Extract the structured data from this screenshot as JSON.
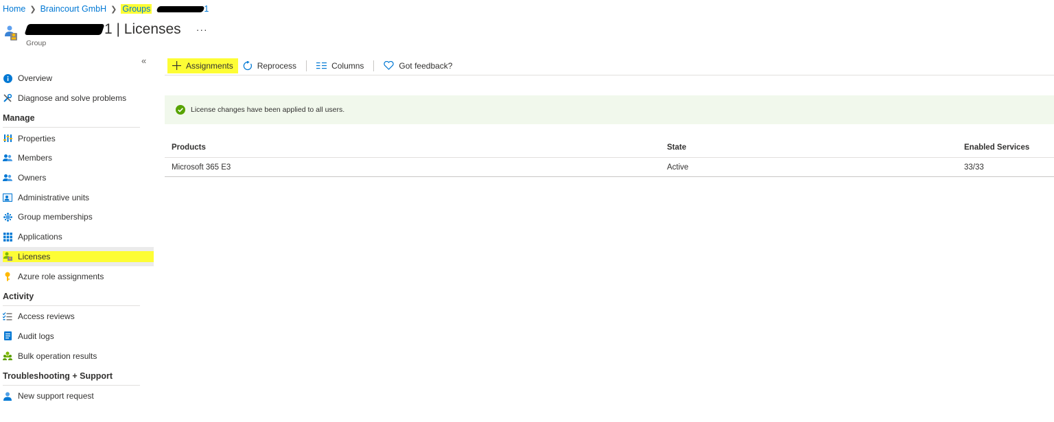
{
  "breadcrumb": {
    "items": [
      "Home",
      "Braincourt GmbH",
      "Groups"
    ],
    "last_suffix": "1",
    "separator": ">"
  },
  "header": {
    "title_suffix": "1 | Licenses",
    "subtitle": "Group",
    "more": "···"
  },
  "sidebar": {
    "collapse": "«",
    "top_items": [
      {
        "label": "Overview",
        "icon": "info-icon"
      },
      {
        "label": "Diagnose and solve problems",
        "icon": "wrench-icon"
      }
    ],
    "sections": [
      {
        "title": "Manage",
        "items": [
          {
            "label": "Properties",
            "icon": "properties-icon"
          },
          {
            "label": "Members",
            "icon": "members-icon"
          },
          {
            "label": "Owners",
            "icon": "owners-icon"
          },
          {
            "label": "Administrative units",
            "icon": "admin-units-icon"
          },
          {
            "label": "Group memberships",
            "icon": "group-memberships-icon"
          },
          {
            "label": "Applications",
            "icon": "applications-icon"
          },
          {
            "label": "Licenses",
            "icon": "licenses-icon",
            "active": true
          },
          {
            "label": "Azure role assignments",
            "icon": "key-icon"
          }
        ]
      },
      {
        "title": "Activity",
        "items": [
          {
            "label": "Access reviews",
            "icon": "access-reviews-icon"
          },
          {
            "label": "Audit logs",
            "icon": "audit-logs-icon"
          },
          {
            "label": "Bulk operation results",
            "icon": "bulk-operation-icon"
          }
        ]
      },
      {
        "title": "Troubleshooting + Support",
        "items": [
          {
            "label": "New support request",
            "icon": "support-request-icon"
          }
        ]
      }
    ]
  },
  "toolbar": {
    "assignments": "Assignments",
    "reprocess": "Reprocess",
    "columns": "Columns",
    "feedback": "Got feedback?"
  },
  "notice": {
    "text": "License changes have been applied to all users."
  },
  "table": {
    "columns": [
      "Products",
      "State",
      "Enabled Services"
    ],
    "rows": [
      [
        "Microsoft 365 E3",
        "Active",
        "33/33"
      ]
    ]
  },
  "colors": {
    "link": "#0078d4",
    "highlight": "#fdfd35",
    "success": "#57a300",
    "notice_bg": "#f1f8ec"
  }
}
